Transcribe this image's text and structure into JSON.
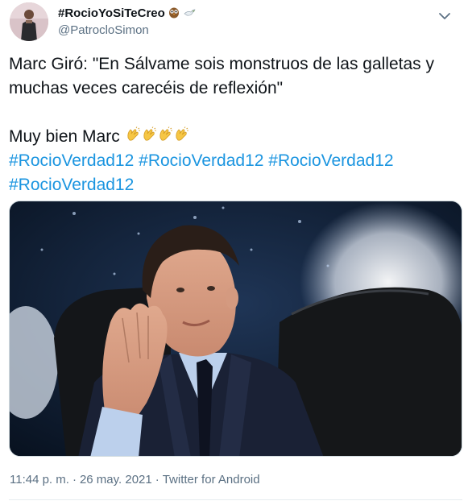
{
  "author": {
    "display_name": "#RocioYoSiTeCreo",
    "emojis": [
      "owl-emoji",
      "dove-emoji"
    ],
    "handle": "@PatrocloSimon"
  },
  "tweet": {
    "line1": "Marc Giró: \"En Sálvame sois monstruos de las galletas y",
    "line2": "muchas veces carecéis de reflexión\"",
    "line3": "Muy bien Marc ",
    "clap_count": 4,
    "hashtags": [
      "#RocioVerdad12",
      "#RocioVerdad12",
      "#RocioVerdad12",
      "#RocioVerdad12"
    ]
  },
  "meta": {
    "time": "11:44 p. m.",
    "separator1": "·",
    "date": "26 may. 2021",
    "separator2": "·",
    "source": "Twitter for Android"
  },
  "colors": {
    "link": "#1b95e0",
    "secondary_text": "#5b7083",
    "primary_text": "#0f1419"
  }
}
